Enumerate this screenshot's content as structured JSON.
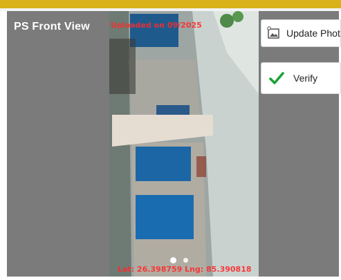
{
  "header": {
    "title": "PS Front View"
  },
  "photo": {
    "overlay_top": "Uploaded on 09/2025",
    "overlay_bottom": "Lat: 26.398759  Lng: 85.390818",
    "carousel_total": 2
  },
  "actions": {
    "update_label": "Update Photo",
    "verify_label": "Verify"
  },
  "colors": {
    "accent": "#d9b21a",
    "panel": "#7b7b7b",
    "check": "#1aa33a",
    "overlay_text": "#ff2a2a"
  }
}
